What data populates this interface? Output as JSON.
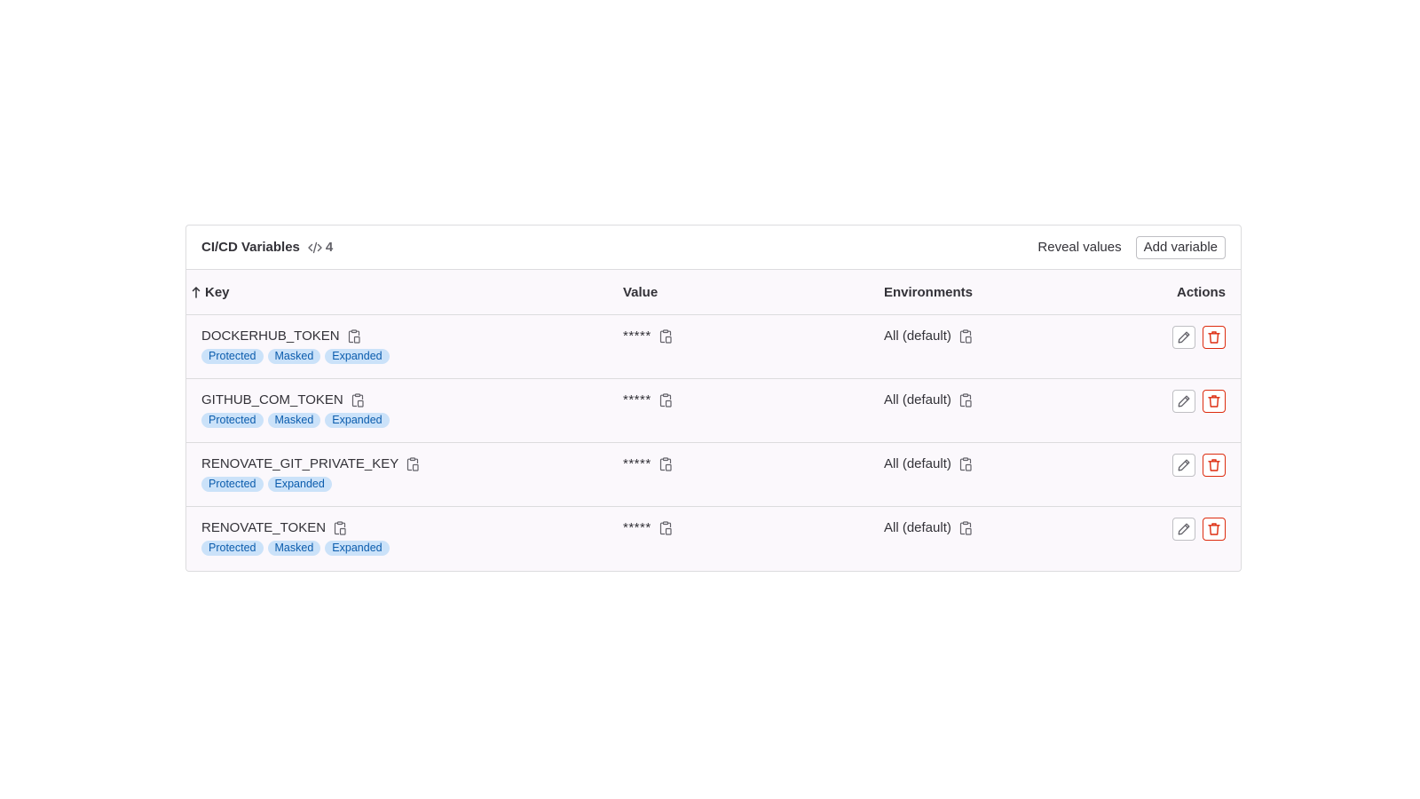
{
  "header": {
    "title": "CI/CD Variables",
    "count_icon": "code-icon",
    "count": "4",
    "reveal_label": "Reveal values",
    "add_label": "Add variable"
  },
  "columns": {
    "key": "Key",
    "value": "Value",
    "environments": "Environments",
    "actions": "Actions"
  },
  "rows": [
    {
      "key": "DOCKERHUB_TOKEN",
      "badges": [
        "Protected",
        "Masked",
        "Expanded"
      ],
      "value": "*****",
      "environment": "All (default)"
    },
    {
      "key": "GITHUB_COM_TOKEN",
      "badges": [
        "Protected",
        "Masked",
        "Expanded"
      ],
      "value": "*****",
      "environment": "All (default)"
    },
    {
      "key": "RENOVATE_GIT_PRIVATE_KEY",
      "badges": [
        "Protected",
        "Expanded"
      ],
      "value": "*****",
      "environment": "All (default)"
    },
    {
      "key": "RENOVATE_TOKEN",
      "badges": [
        "Protected",
        "Masked",
        "Expanded"
      ],
      "value": "*****",
      "environment": "All (default)"
    }
  ],
  "colors": {
    "badge_bg": "#cbe2f9",
    "badge_text": "#0b5cad",
    "danger": "#dd2b0e",
    "row_bg": "#fbf8fc"
  }
}
